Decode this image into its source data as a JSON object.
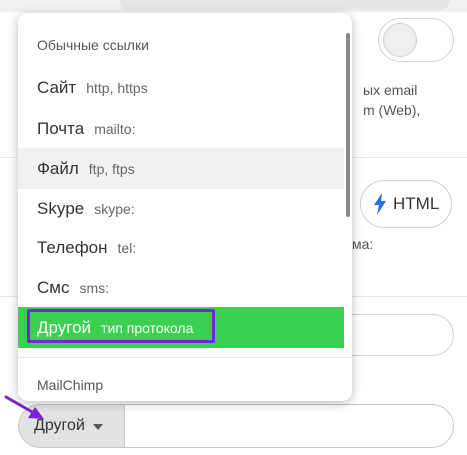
{
  "background": {
    "right_text_lines": [
      "ых email",
      "m (Web),"
    ],
    "html_button_label": "HTML",
    "mid_text": "ма:"
  },
  "dropdown": {
    "header": "Обычные ссылки",
    "items": [
      {
        "name": "Сайт",
        "protocol": "http, https"
      },
      {
        "name": "Почта",
        "protocol": "mailto:"
      },
      {
        "name": "Файл",
        "protocol": "ftp, ftps"
      },
      {
        "name": "Skype",
        "protocol": "skype:"
      },
      {
        "name": "Телефон",
        "protocol": "tel:"
      },
      {
        "name": "Смс",
        "protocol": "sms:"
      },
      {
        "name": "Другой",
        "protocol": "тип протокола"
      }
    ],
    "hovered_item": "Файл",
    "selected_item": "Другой",
    "footer_group": "MailChimp"
  },
  "link_type_select": {
    "value": "Другой"
  },
  "colors": {
    "selected_bg": "#3bd04f",
    "highlight_outline": "#7b23d6",
    "bolt_icon": "#1a73e8"
  }
}
